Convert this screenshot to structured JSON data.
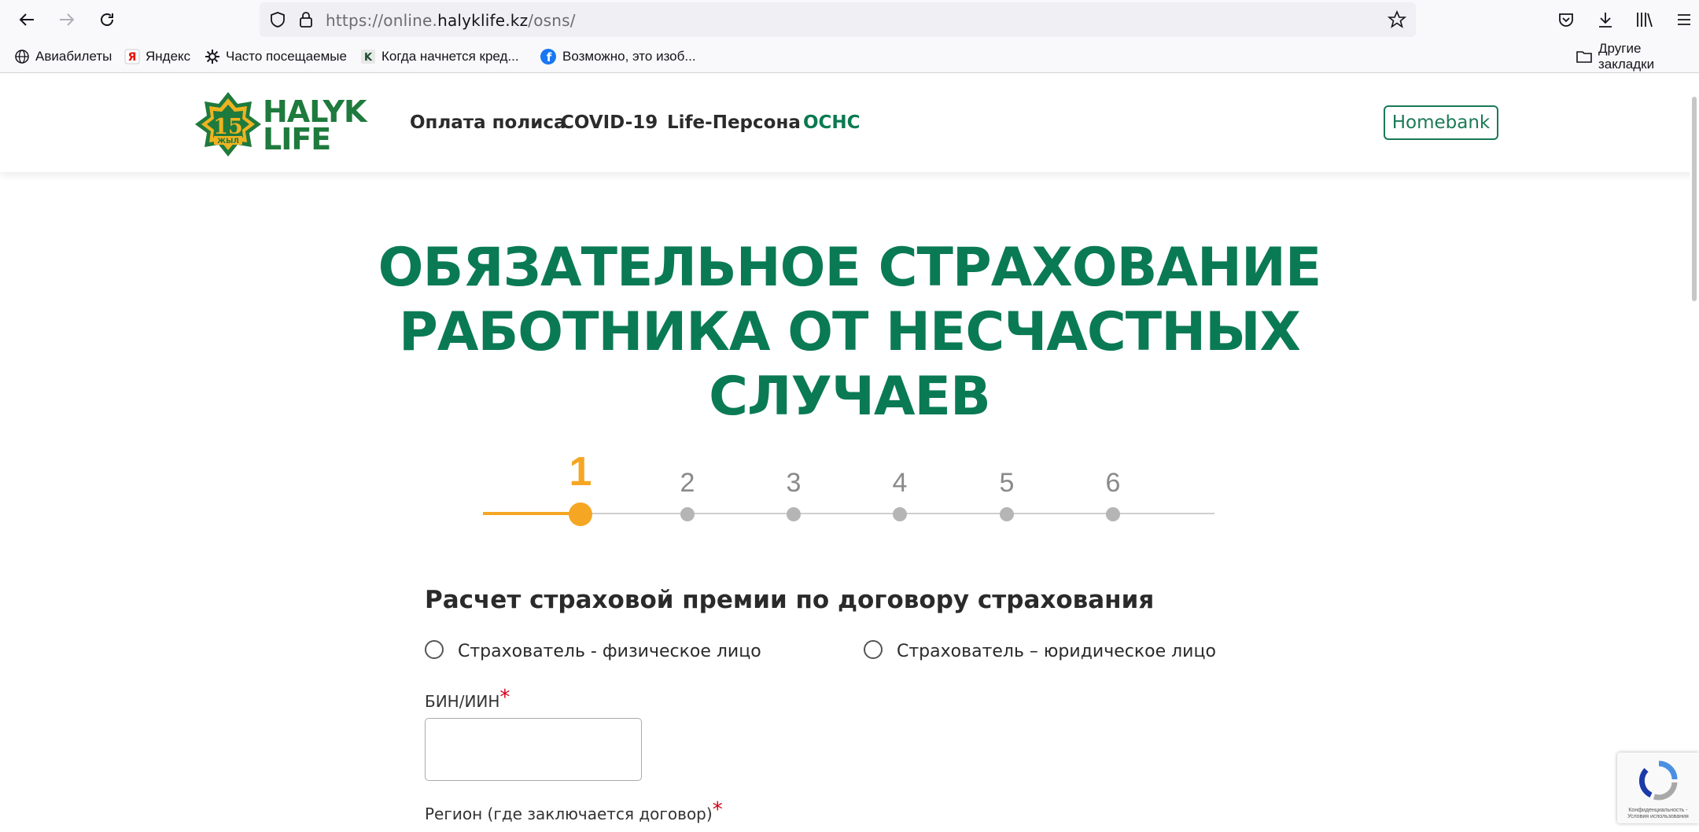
{
  "browser": {
    "url_prefix": "https://online.",
    "url_domain": "halyklife.kz",
    "url_path": "/osns/",
    "bookmarks": [
      {
        "label": "Авиабилеты",
        "icon": "globe-icon"
      },
      {
        "label": "Яндекс",
        "icon": "yandex-icon"
      },
      {
        "label": "Часто посещаемые",
        "icon": "gear-icon"
      },
      {
        "label": "Когда начнется кред...",
        "icon": "k-icon"
      },
      {
        "label": "Возможно, это изоб...",
        "icon": "facebook-icon"
      }
    ],
    "other_bookmarks": "Другие закладки"
  },
  "header": {
    "logo_text_top": "HALYK",
    "logo_text_bottom": "LIFE",
    "logo_badge_number": "15",
    "logo_badge_word": "ЖЫЛ",
    "nav": [
      {
        "label": "Оплата полиса",
        "active": false
      },
      {
        "label": "COVID-19",
        "active": false
      },
      {
        "label": "Life-Персона",
        "active": false
      },
      {
        "label": "ОСНС",
        "active": true
      }
    ],
    "homebank_label": "Homebank"
  },
  "main": {
    "title_line1": "ОБЯЗАТЕЛЬНОЕ СТРАХОВАНИЕ",
    "title_line2": "РАБОТНИКА ОТ НЕСЧАСТНЫХ",
    "title_line3": "СЛУЧАЕВ",
    "steps": [
      "1",
      "2",
      "3",
      "4",
      "5",
      "6"
    ],
    "active_step": 1,
    "section_title": "Расчет страховой премии по договору страхования",
    "radio_individual": "Страхователь - физическое лицо",
    "radio_legal": "Страхователь – юридическое лицо",
    "bin_label": "БИН/ИИН",
    "bin_value": "",
    "region_label": "Регион (где заключается договор)",
    "required_mark": "*"
  },
  "recaptcha": {
    "text": "Конфиденциальность - Условия использования"
  },
  "colors": {
    "brand_green": "#0a7a55",
    "accent_orange": "#f5a623",
    "required_red": "#d0021b"
  }
}
